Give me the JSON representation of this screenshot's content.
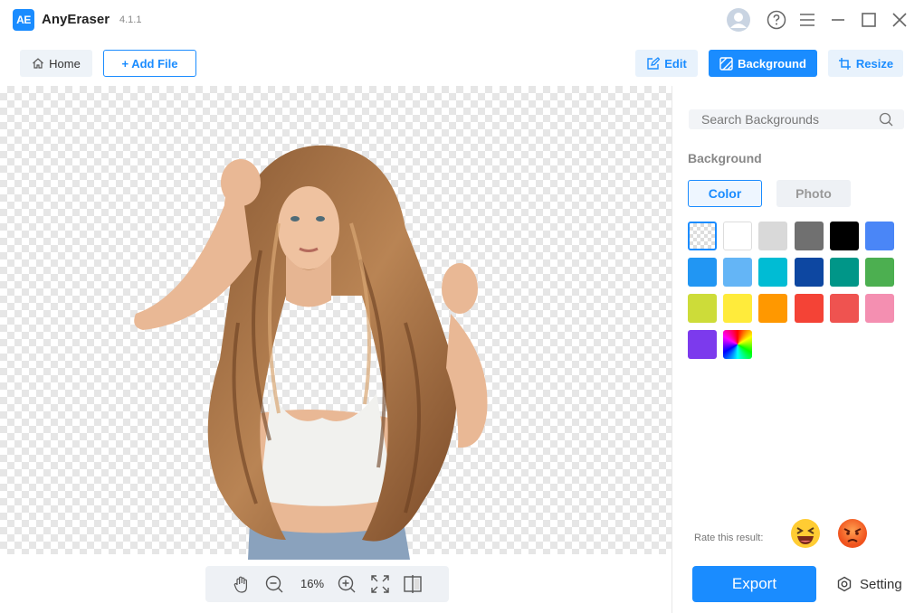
{
  "app": {
    "logo_text": "AE",
    "name": "AnyEraser",
    "version": "4.1.1"
  },
  "titlebar": {
    "icons": [
      "avatar-icon",
      "help-icon",
      "menu-icon",
      "minimize-icon",
      "maximize-icon",
      "close-icon"
    ]
  },
  "toolbar": {
    "home_label": "Home",
    "add_file_label": "+ Add File",
    "edit_label": "Edit",
    "background_label": "Background",
    "resize_label": "Resize"
  },
  "zoom": {
    "value": "16%"
  },
  "panel": {
    "search_placeholder": "Search Backgrounds",
    "section_title": "Background",
    "tabs": {
      "color": "Color",
      "photo": "Photo"
    },
    "selected_tab": "Color",
    "swatches": [
      "transparent",
      "#ffffff",
      "#d9d9d9",
      "#707070",
      "#000000",
      "#4a86f7",
      "#2196f3",
      "#64b5f6",
      "#00bcd4",
      "#0d47a1",
      "#009688",
      "#4caf50",
      "#cddc39",
      "#ffeb3b",
      "#ff9800",
      "#f44336",
      "#ef5350",
      "#f48fb1",
      "#7c3aed",
      "rainbow"
    ],
    "rate_label": "Rate this result:",
    "export_label": "Export",
    "setting_label": "Setting"
  },
  "colors": {
    "accent": "#1a8cff"
  }
}
